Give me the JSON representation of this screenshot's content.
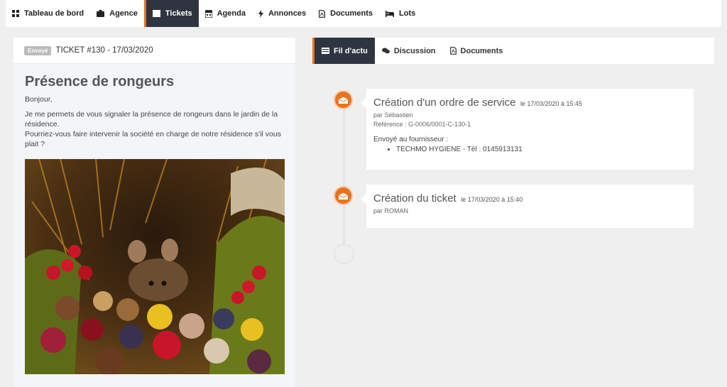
{
  "nav": {
    "items": [
      {
        "label": "Tableau de bord",
        "icon": "dashboard-grid-icon"
      },
      {
        "label": "Agence",
        "icon": "briefcase-icon"
      },
      {
        "label": "Tickets",
        "icon": "ticket-list-icon",
        "active": true
      },
      {
        "label": "Agenda",
        "icon": "calendar-icon"
      },
      {
        "label": "Annonces",
        "icon": "bolt-icon"
      },
      {
        "label": "Documents",
        "icon": "file-pdf-icon"
      },
      {
        "label": "Lots",
        "icon": "bed-icon"
      }
    ]
  },
  "ticket": {
    "badge": "Envoyé",
    "header": "TICKET #130 - 17/03/2020",
    "title": "Présence de rongeurs",
    "greeting": "Bonjour,",
    "body_line1": "Je me permets de vous signaler la présence de rongeurs dans le jardin de la résidence.",
    "body_line2": "Pourriez-vous faire intervenir la société en charge de notre résidence s'il vous plait ?"
  },
  "tabs": [
    {
      "label": "Fil d'actu",
      "icon": "list-icon",
      "active": true
    },
    {
      "label": "Discussion",
      "icon": "comments-icon"
    },
    {
      "label": "Documents",
      "icon": "file-pdf-icon"
    }
  ],
  "timeline": [
    {
      "title": "Création d'un ordre de service",
      "date": "le 17/03/2020 à 15:45",
      "by": "par Sébastien",
      "reference": "Référence : G-0006/0001-C-130-1",
      "sent_label": "Envoyé au fournisseur :",
      "supplier": "TECHMO HYGIENE - Tél : 0145913131"
    },
    {
      "title": "Création du ticket",
      "date": "le 17/03/2020 à 15:40",
      "by": "par ROMAN"
    }
  ],
  "colors": {
    "accent": "#e8731f",
    "nav_active_bg": "#2e3540"
  }
}
